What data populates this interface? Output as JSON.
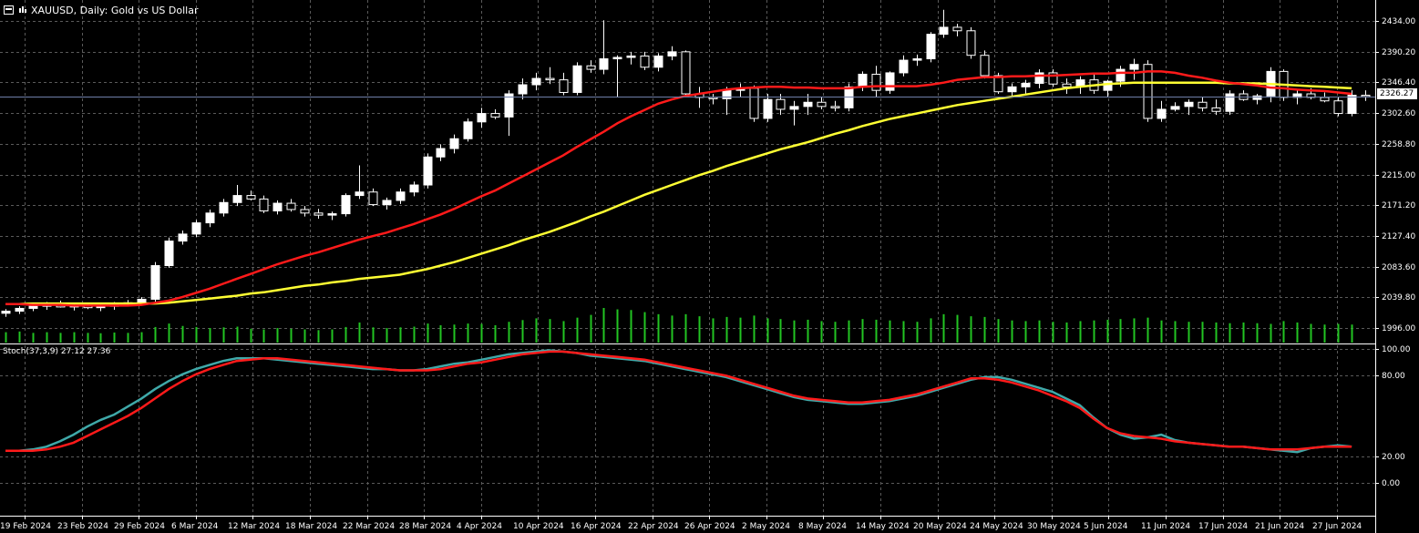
{
  "window": {
    "title": "XAUUSD, Daily:  Gold vs US Dollar",
    "icons": [
      "chart-window-icon",
      "bar-chart-icon"
    ]
  },
  "price_panel": {
    "current_price": "2326.27",
    "y_ticks": [
      "2434.00",
      "2390.20",
      "2346.40",
      "2302.60",
      "2258.80",
      "2215.00",
      "2171.20",
      "2127.40",
      "2083.60",
      "2039.80",
      "1996.00"
    ]
  },
  "stoch_panel": {
    "label": "Stoch(37,3,9) 27.12 27.36",
    "y_ticks": [
      "100.00",
      "80.00",
      "20.00",
      "0.00"
    ]
  },
  "x_ticks": [
    "19 Feb 2024",
    "23 Feb 2024",
    "29 Feb 2024",
    "6 Mar 2024",
    "12 Mar 2024",
    "18 Mar 2024",
    "22 Mar 2024",
    "28 Mar 2024",
    "4 Apr 2024",
    "10 Apr 2024",
    "16 Apr 2024",
    "22 Apr 2024",
    "26 Apr 2024",
    "2 May 2024",
    "8 May 2024",
    "14 May 2024",
    "20 May 2024",
    "24 May 2024",
    "30 May 2024",
    "5 Jun 2024",
    "11 Jun 2024",
    "17 Jun 2024",
    "21 Jun 2024",
    "27 Jun 2024"
  ],
  "colors": {
    "background": "#000000",
    "grid": "#5a5a5a",
    "bull_candle": "#ffffff",
    "bear_candle": "#000000",
    "wick": "#ffffff",
    "ma_fast": "#ff1a1a",
    "ma_slow": "#ffff33",
    "volume": "#22c422",
    "stoch_main": "#3fa9a9",
    "stoch_signal": "#ff1a1a",
    "axis_text": "#ffffff"
  },
  "chart_data": [
    {
      "type": "candlestick",
      "title": "XAUUSD, Daily:  Gold vs US Dollar",
      "ylim": [
        1980,
        2450
      ],
      "candles": [
        [
          2017,
          2023,
          2012,
          2020
        ],
        [
          2020,
          2027,
          2016,
          2024
        ],
        [
          2024,
          2030,
          2020,
          2027
        ],
        [
          2027,
          2033,
          2022,
          2030
        ],
        [
          2030,
          2035,
          2025,
          2026
        ],
        [
          2026,
          2031,
          2021,
          2028
        ],
        [
          2028,
          2032,
          2023,
          2025
        ],
        [
          2025,
          2030,
          2020,
          2027
        ],
        [
          2027,
          2033,
          2022,
          2031
        ],
        [
          2031,
          2036,
          2027,
          2032
        ],
        [
          2032,
          2040,
          2028,
          2037
        ],
        [
          2037,
          2090,
          2033,
          2085
        ],
        [
          2085,
          2125,
          2082,
          2120
        ],
        [
          2120,
          2135,
          2115,
          2130
        ],
        [
          2130,
          2150,
          2126,
          2146
        ],
        [
          2146,
          2165,
          2140,
          2160
        ],
        [
          2160,
          2180,
          2155,
          2175
        ],
        [
          2175,
          2200,
          2170,
          2185
        ],
        [
          2185,
          2192,
          2178,
          2180
        ],
        [
          2180,
          2185,
          2160,
          2163
        ],
        [
          2163,
          2178,
          2158,
          2174
        ],
        [
          2174,
          2180,
          2162,
          2165
        ],
        [
          2165,
          2170,
          2155,
          2160
        ],
        [
          2160,
          2166,
          2152,
          2157
        ],
        [
          2157,
          2162,
          2150,
          2159
        ],
        [
          2159,
          2188,
          2155,
          2185
        ],
        [
          2185,
          2228,
          2180,
          2190
        ],
        [
          2190,
          2195,
          2170,
          2172
        ],
        [
          2172,
          2182,
          2165,
          2178
        ],
        [
          2178,
          2195,
          2173,
          2190
        ],
        [
          2190,
          2205,
          2184,
          2200
        ],
        [
          2200,
          2245,
          2195,
          2240
        ],
        [
          2240,
          2258,
          2234,
          2252
        ],
        [
          2252,
          2272,
          2245,
          2266
        ],
        [
          2266,
          2295,
          2262,
          2290
        ],
        [
          2290,
          2310,
          2282,
          2302
        ],
        [
          2302,
          2308,
          2294,
          2297
        ],
        [
          2297,
          2335,
          2270,
          2330
        ],
        [
          2330,
          2352,
          2322,
          2343
        ],
        [
          2343,
          2360,
          2335,
          2352
        ],
        [
          2352,
          2368,
          2344,
          2350
        ],
        [
          2350,
          2360,
          2328,
          2332
        ],
        [
          2332,
          2375,
          2328,
          2370
        ],
        [
          2370,
          2378,
          2360,
          2365
        ],
        [
          2365,
          2435,
          2358,
          2380
        ],
        [
          2380,
          2385,
          2325,
          2382
        ],
        [
          2382,
          2390,
          2372,
          2384
        ],
        [
          2384,
          2390,
          2364,
          2368
        ],
        [
          2368,
          2388,
          2362,
          2384
        ],
        [
          2384,
          2398,
          2378,
          2390
        ],
        [
          2390,
          2392,
          2325,
          2330
        ],
        [
          2330,
          2340,
          2310,
          2325
        ],
        [
          2325,
          2330,
          2315,
          2323
        ],
        [
          2323,
          2340,
          2300,
          2335
        ],
        [
          2335,
          2345,
          2325,
          2338
        ],
        [
          2338,
          2342,
          2290,
          2295
        ],
        [
          2295,
          2330,
          2290,
          2322
        ],
        [
          2322,
          2330,
          2300,
          2308
        ],
        [
          2308,
          2320,
          2285,
          2312
        ],
        [
          2312,
          2330,
          2300,
          2318
        ],
        [
          2318,
          2325,
          2308,
          2312
        ],
        [
          2312,
          2320,
          2305,
          2310
        ],
        [
          2310,
          2345,
          2305,
          2340
        ],
        [
          2340,
          2362,
          2334,
          2358
        ],
        [
          2358,
          2370,
          2325,
          2335
        ],
        [
          2335,
          2362,
          2330,
          2360
        ],
        [
          2360,
          2385,
          2355,
          2378
        ],
        [
          2378,
          2386,
          2370,
          2380
        ],
        [
          2380,
          2418,
          2375,
          2415
        ],
        [
          2415,
          2450,
          2410,
          2425
        ],
        [
          2425,
          2430,
          2412,
          2420
        ],
        [
          2420,
          2425,
          2380,
          2385
        ],
        [
          2385,
          2392,
          2352,
          2356
        ],
        [
          2356,
          2360,
          2330,
          2333
        ],
        [
          2333,
          2345,
          2325,
          2340
        ],
        [
          2340,
          2350,
          2328,
          2345
        ],
        [
          2345,
          2365,
          2338,
          2360
        ],
        [
          2360,
          2365,
          2340,
          2344
        ],
        [
          2344,
          2352,
          2330,
          2340
        ],
        [
          2340,
          2355,
          2330,
          2350
        ],
        [
          2350,
          2358,
          2330,
          2335
        ],
        [
          2335,
          2350,
          2325,
          2348
        ],
        [
          2348,
          2370,
          2340,
          2365
        ],
        [
          2365,
          2380,
          2350,
          2372
        ],
        [
          2372,
          2378,
          2290,
          2295
        ],
        [
          2295,
          2320,
          2290,
          2308
        ],
        [
          2308,
          2318,
          2305,
          2312
        ],
        [
          2312,
          2322,
          2300,
          2318
        ],
        [
          2318,
          2325,
          2305,
          2310
        ],
        [
          2310,
          2322,
          2300,
          2305
        ],
        [
          2305,
          2335,
          2300,
          2330
        ],
        [
          2330,
          2335,
          2320,
          2322
        ],
        [
          2322,
          2330,
          2315,
          2327
        ],
        [
          2327,
          2368,
          2318,
          2362
        ],
        [
          2362,
          2365,
          2320,
          2325
        ],
        [
          2325,
          2335,
          2315,
          2330
        ],
        [
          2330,
          2338,
          2322,
          2325
        ],
        [
          2325,
          2332,
          2318,
          2320
        ],
        [
          2320,
          2325,
          2298,
          2302
        ],
        [
          2302,
          2335,
          2298,
          2328
        ],
        [
          2328,
          2335,
          2320,
          2326
        ]
      ],
      "ma_fast": [
        2030,
        2030,
        2029,
        2029,
        2029,
        2028,
        2028,
        2028,
        2028,
        2028,
        2029,
        2032,
        2035,
        2040,
        2046,
        2052,
        2059,
        2066,
        2073,
        2080,
        2087,
        2093,
        2099,
        2104,
        2110,
        2116,
        2122,
        2127,
        2132,
        2138,
        2144,
        2151,
        2158,
        2166,
        2175,
        2184,
        2192,
        2202,
        2212,
        2222,
        2232,
        2242,
        2254,
        2265,
        2276,
        2288,
        2298,
        2307,
        2316,
        2322,
        2327,
        2330,
        2333,
        2336,
        2338,
        2339,
        2340,
        2340,
        2339,
        2339,
        2338,
        2338,
        2338,
        2340,
        2341,
        2341,
        2341,
        2341,
        2343,
        2346,
        2350,
        2352,
        2354,
        2354,
        2355,
        2355,
        2356,
        2356,
        2357,
        2358,
        2359,
        2359,
        2360,
        2360,
        2362,
        2362,
        2360,
        2356,
        2353,
        2349,
        2346,
        2344,
        2342,
        2339,
        2338,
        2336,
        2335,
        2334,
        2332,
        2330
      ],
      "ma_slow": [
        2030,
        2030,
        2031,
        2031,
        2031,
        2031,
        2031,
        2031,
        2031,
        2031,
        2031,
        2031,
        2032,
        2034,
        2036,
        2038,
        2040,
        2042,
        2045,
        2047,
        2050,
        2053,
        2056,
        2058,
        2061,
        2063,
        2066,
        2068,
        2070,
        2072,
        2076,
        2080,
        2085,
        2090,
        2096,
        2102,
        2108,
        2114,
        2121,
        2127,
        2133,
        2140,
        2147,
        2155,
        2162,
        2170,
        2178,
        2186,
        2193,
        2200,
        2207,
        2214,
        2220,
        2227,
        2233,
        2239,
        2245,
        2251,
        2256,
        2261,
        2267,
        2273,
        2278,
        2284,
        2289,
        2294,
        2298,
        2302,
        2306,
        2310,
        2314,
        2317,
        2320,
        2323,
        2326,
        2329,
        2332,
        2335,
        2338,
        2340,
        2342,
        2344,
        2345,
        2346,
        2346,
        2346,
        2346,
        2346,
        2346,
        2346,
        2345,
        2345,
        2345,
        2344,
        2343,
        2342,
        2341,
        2340,
        2339,
        2338
      ],
      "volume": [
        30,
        32,
        28,
        30,
        28,
        30,
        28,
        27,
        29,
        28,
        30,
        45,
        55,
        48,
        45,
        42,
        44,
        46,
        40,
        38,
        42,
        40,
        38,
        36,
        38,
        45,
        58,
        44,
        42,
        44,
        46,
        55,
        50,
        52,
        55,
        54,
        50,
        60,
        65,
        70,
        68,
        62,
        72,
        80,
        100,
        96,
        94,
        88,
        82,
        78,
        82,
        76,
        70,
        74,
        72,
        78,
        70,
        68,
        64,
        66,
        62,
        60,
        64,
        68,
        66,
        64,
        62,
        60,
        70,
        82,
        80,
        76,
        74,
        68,
        64,
        62,
        64,
        60,
        58,
        62,
        64,
        66,
        68,
        70,
        72,
        64,
        62,
        60,
        60,
        58,
        56,
        58,
        56,
        54,
        62,
        58,
        54,
        52,
        54,
        52
      ]
    },
    {
      "type": "line",
      "title": "Stoch(37,3,9) 27.12 27.36",
      "ylim": [
        0,
        100
      ],
      "series": [
        {
          "name": "main",
          "values": [
            24,
            24,
            25,
            27,
            31,
            36,
            42,
            47,
            51,
            57,
            63,
            70,
            76,
            81,
            85,
            88,
            91,
            93,
            93,
            93,
            92,
            91,
            90,
            89,
            88,
            87,
            86,
            85,
            85,
            84,
            84,
            85,
            87,
            89,
            90,
            92,
            94,
            96,
            97,
            98,
            99,
            98,
            97,
            95,
            94,
            93,
            92,
            91,
            89,
            87,
            85,
            83,
            81,
            79,
            76,
            73,
            70,
            67,
            64,
            62,
            61,
            60,
            59,
            59,
            60,
            61,
            63,
            65,
            68,
            71,
            74,
            77,
            79,
            79,
            77,
            74,
            71,
            68,
            63,
            58,
            49,
            41,
            36,
            33,
            34,
            36,
            32,
            30,
            29,
            28,
            27,
            27,
            26,
            25,
            24,
            23,
            26,
            27,
            28,
            27
          ]
        },
        {
          "name": "signal",
          "values": [
            24,
            24,
            24,
            25,
            27,
            30,
            35,
            40,
            45,
            50,
            56,
            63,
            70,
            76,
            81,
            85,
            88,
            91,
            92,
            93,
            93,
            92,
            91,
            90,
            89,
            88,
            87,
            86,
            85,
            84,
            84,
            84,
            85,
            87,
            89,
            90,
            92,
            94,
            96,
            97,
            98,
            98,
            97,
            96,
            95,
            94,
            93,
            92,
            90,
            88,
            86,
            84,
            82,
            80,
            77,
            74,
            71,
            68,
            65,
            63,
            62,
            61,
            60,
            60,
            61,
            62,
            64,
            66,
            69,
            72,
            75,
            78,
            78,
            77,
            75,
            72,
            69,
            65,
            61,
            56,
            48,
            41,
            37,
            35,
            34,
            33,
            31,
            30,
            29,
            28,
            27,
            27,
            26,
            25,
            25,
            25,
            26,
            27,
            27,
            27
          ]
        }
      ]
    }
  ]
}
